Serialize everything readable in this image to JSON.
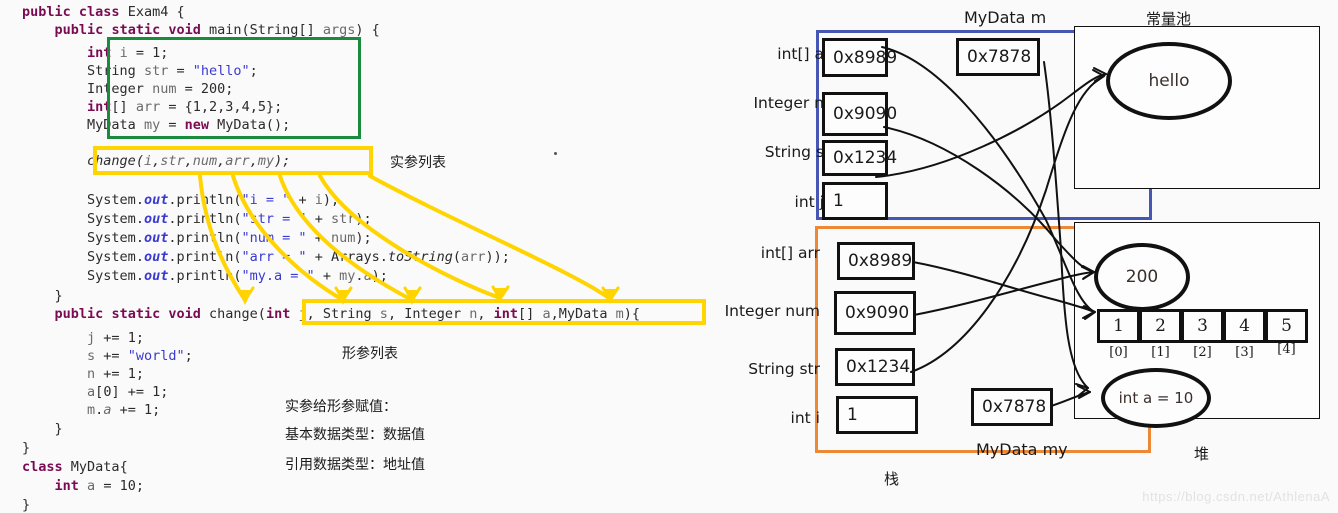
{
  "code": {
    "lines": [
      {
        "id": "l1",
        "text": "public class Exam4 {"
      },
      {
        "id": "l2",
        "text": "    public static void main(String[] args) {"
      },
      {
        "id": "l3",
        "text": "        int i = 1;"
      },
      {
        "id": "l4",
        "text": "        String str = \"hello\";"
      },
      {
        "id": "l5",
        "text": "        Integer num = 200;"
      },
      {
        "id": "l6",
        "text": "        int[] arr = {1,2,3,4,5};"
      },
      {
        "id": "l7",
        "text": "        MyData my = new MyData();"
      },
      {
        "id": "l8",
        "text": "        change(i,str,num,arr,my);"
      },
      {
        "id": "l9",
        "text": "        System.out.println(\"i = \" + i);"
      },
      {
        "id": "l10",
        "text": "        System.out.println(\"str = \" + str);"
      },
      {
        "id": "l11",
        "text": "        System.out.println(\"num = \" + num);"
      },
      {
        "id": "l12",
        "text": "        System.out.println(\"arr = \" + Arrays.toString(arr));"
      },
      {
        "id": "l13",
        "text": "        System.out.println(\"my.a = \" + my.a);"
      },
      {
        "id": "l14",
        "text": "    }"
      },
      {
        "id": "l15",
        "text": "    public static void change(int j, String s, Integer n, int[] a,MyData m){"
      },
      {
        "id": "l16",
        "text": "        j += 1;"
      },
      {
        "id": "l17",
        "text": "        s += \"world\";"
      },
      {
        "id": "l18",
        "text": "        n += 1;"
      },
      {
        "id": "l19",
        "text": "        a[0] += 1;"
      },
      {
        "id": "l20",
        "text": "        m.a += 1;"
      },
      {
        "id": "l21",
        "text": "    }"
      },
      {
        "id": "l22",
        "text": "}"
      },
      {
        "id": "l23",
        "text": "class MyData{"
      },
      {
        "id": "l24",
        "text": "    int a = 10;"
      },
      {
        "id": "l25",
        "text": "}"
      }
    ]
  },
  "annotations": {
    "actual_args_list": "实参列表",
    "formal_params_list": "形参列表",
    "assign_title": "实参给形参赋值：",
    "assign_primitive": "基本数据类型：数据值",
    "assign_reference": "引用数据类型：地址值"
  },
  "diagram": {
    "upper_frame": {
      "title": "MyData m",
      "slots": [
        {
          "label": "int[]  a",
          "value": "0x8989"
        },
        {
          "label": "Integer n",
          "value": "0x9090"
        },
        {
          "label": "String  s",
          "value": "0x1234"
        },
        {
          "label": "int  j",
          "value": "1"
        }
      ],
      "extra_cell": "0x7878",
      "border_color": "#4556b5"
    },
    "lower_frame": {
      "title": "MyData my",
      "slots": [
        {
          "label": "int[]    arr",
          "value": "0x8989"
        },
        {
          "label": "Integer num",
          "value": "0x9090"
        },
        {
          "label": "String str",
          "value": "0x1234"
        },
        {
          "label": "int  i",
          "value": "1"
        }
      ],
      "extra_cell": "0x7878",
      "border_color": "#ed8936"
    },
    "stack_label": "栈",
    "constant_pool": {
      "title": "常量池",
      "items": [
        "hello"
      ]
    },
    "heap": {
      "title": "堆",
      "integer_object": "200",
      "array": {
        "values": [
          "1",
          "2",
          "3",
          "4",
          "5"
        ],
        "indices": [
          "[0]",
          "[1]",
          "[2]",
          "[3]",
          "[4]"
        ]
      },
      "mydata_object": "int a = 10"
    }
  },
  "watermark": {
    "url": "https://blog.csdn.net/AthlenaA"
  }
}
